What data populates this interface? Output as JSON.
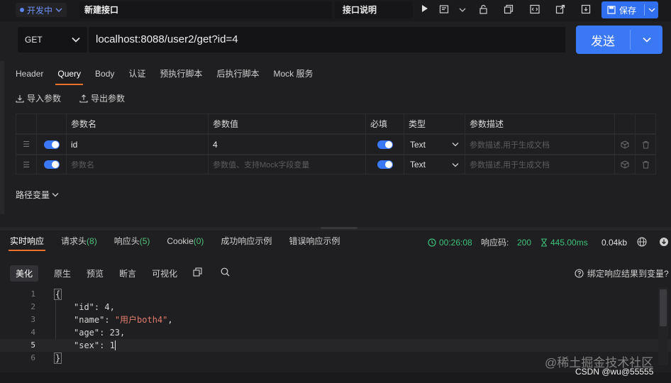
{
  "topbar": {
    "status": "开发中",
    "api_name": "新建接口",
    "doc_label": "接口说明",
    "save_label": "保存"
  },
  "request": {
    "method": "GET",
    "url": "localhost:8088/user2/get?id=4",
    "send_label": "发送"
  },
  "tabs": [
    "Header",
    "Query",
    "Body",
    "认证",
    "预执行脚本",
    "后执行脚本",
    "Mock 服务"
  ],
  "active_tab": "Query",
  "param_actions": {
    "import": "导入参数",
    "export": "导出参数"
  },
  "params_table": {
    "headers": {
      "name": "参数名",
      "value": "参数值",
      "required": "必填",
      "type": "类型",
      "desc": "参数描述"
    },
    "rows": [
      {
        "name": "id",
        "value": "4",
        "type": "Text",
        "desc_placeholder": "参数描述,用于生成文档",
        "enabled": true,
        "required": true
      },
      {
        "name_placeholder": "参数名",
        "value_placeholder": "参数值、支持Mock字段变量",
        "type": "Text",
        "desc_placeholder": "参数描述,用于生成文档",
        "enabled": true,
        "required": true
      }
    ]
  },
  "path_vars_label": "路径变量",
  "response": {
    "tabs": {
      "realtime": "实时响应",
      "req_headers": "请求头",
      "req_headers_count": "(8)",
      "resp_headers": "响应头",
      "resp_headers_count": "(5)",
      "cookie": "Cookie",
      "cookie_count": "(0)",
      "success_example": "成功响应示例",
      "error_example": "错误响应示例"
    },
    "time": "00:26:08",
    "status_label": "响应码:",
    "status_code": "200",
    "duration": "445.00ms",
    "size": "0.04kb",
    "sub_tabs": [
      "美化",
      "原生",
      "预览",
      "断言",
      "可视化"
    ],
    "bind_label": "绑定响应结果到变量?"
  },
  "code": {
    "line_numbers": [
      "1",
      "2",
      "3",
      "4",
      "5",
      "6"
    ],
    "open": "{",
    "close": "}",
    "k_id": "\"id\"",
    "v_id": "4",
    "k_name": "\"name\"",
    "v_name": "\"用户both4\"",
    "k_age": "\"age\"",
    "v_age": "23",
    "k_sex": "\"sex\"",
    "v_sex": "1"
  },
  "watermark": {
    "text": "@稀土掘金技术社区",
    "csdn": "CSDN @wu@55555"
  },
  "colors": {
    "accent": "#3b78f5",
    "tab_underline": "#e8702a",
    "success": "#3cc07a",
    "string": "#e07c6d"
  }
}
